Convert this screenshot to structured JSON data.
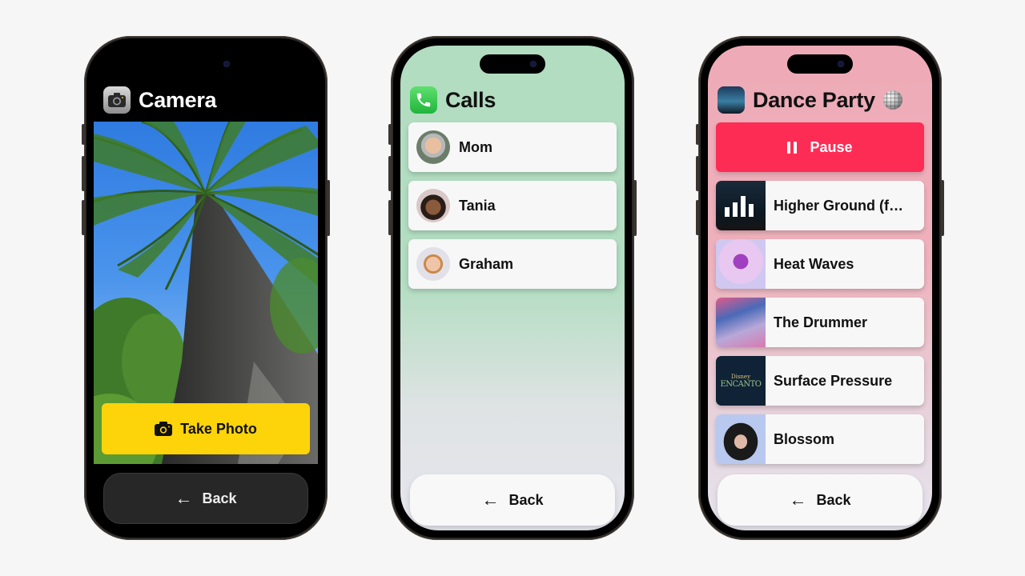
{
  "phones": {
    "camera": {
      "app_title": "Camera",
      "app_icon": "camera-app-icon",
      "take_photo_label": "Take Photo",
      "take_photo_icon": "camera-icon",
      "back_label": "Back",
      "back_icon": "arrow-left-icon",
      "arrow_glyph": "←",
      "colors": {
        "background": "#000000",
        "take_photo": "#fdd30a",
        "back": "#272727"
      }
    },
    "calls": {
      "app_title": "Calls",
      "app_icon": "phone-app-icon",
      "contacts": [
        {
          "name": "Mom"
        },
        {
          "name": "Tania"
        },
        {
          "name": "Graham"
        }
      ],
      "back_label": "Back",
      "back_icon": "arrow-left-icon",
      "arrow_glyph": "←",
      "colors": {
        "background_top": "#b2ddc1",
        "background_bottom": "#e7e6ef"
      }
    },
    "music": {
      "app_title": "Dance Party",
      "title_emoji": "mirror-ball-icon",
      "pause_label": "Pause",
      "pause_icon": "pause-icon",
      "tracks": [
        {
          "title": "Higher Ground (f…"
        },
        {
          "title": "Heat Waves"
        },
        {
          "title": "The Drummer"
        },
        {
          "title": "Surface Pressure",
          "art_text": "ENCANTO",
          "art_subtext": "Disney"
        },
        {
          "title": "Blossom"
        }
      ],
      "back_label": "Back",
      "back_icon": "arrow-left-icon",
      "arrow_glyph": "←",
      "colors": {
        "background_top": "#eeaab6",
        "pause": "#fd2c55"
      }
    }
  }
}
